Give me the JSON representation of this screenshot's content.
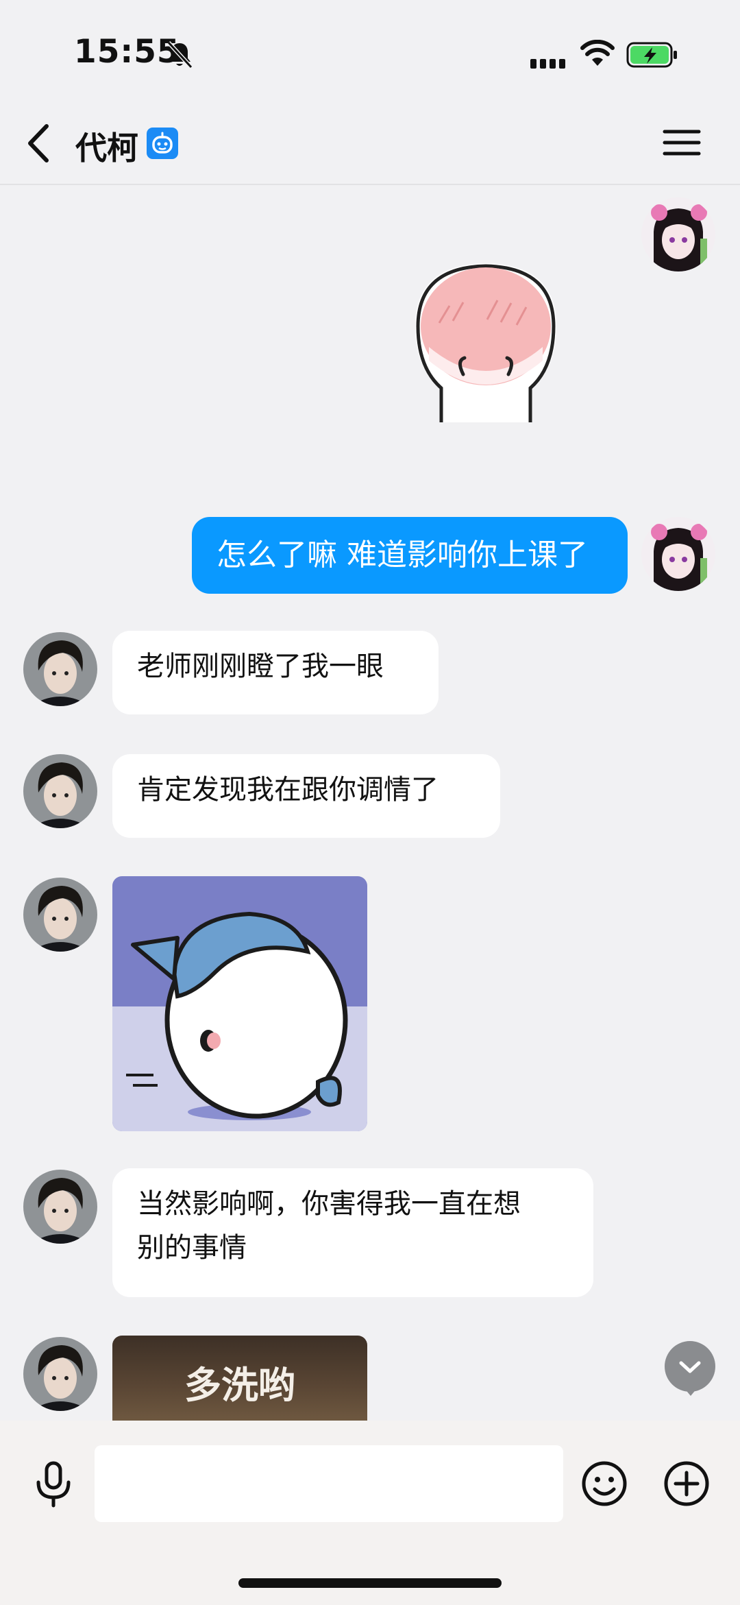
{
  "status_bar": {
    "time": "15:55",
    "icons": [
      "bell-slash-icon",
      "cellular-signal-icon",
      "wifi-icon",
      "battery-charging-icon"
    ],
    "battery_color": "#4cd964"
  },
  "header": {
    "title": "代柯",
    "icons": [
      "back-chevron-icon",
      "robot-badge-icon",
      "menu-icon"
    ]
  },
  "messages": {
    "out_1": "怎么了嘛 难道影响你上课了",
    "in_1": "老师刚刚瞪了我一眼",
    "in_2": "肯定发现我在跟你调情了",
    "in_3_line1": "当然影响啊，你害得我一直在想",
    "in_3_line2": "别的事情",
    "sticker_caption": "多洗哟"
  },
  "input": {
    "placeholder": "",
    "icons": [
      "microphone-icon",
      "emoji-icon",
      "plus-circle-icon"
    ]
  },
  "colors": {
    "outgoing_bubble": "#0a99ff",
    "incoming_bubble": "#ffffff",
    "background": "#f1f1f3",
    "bot_badge": "#1b8bf5"
  }
}
